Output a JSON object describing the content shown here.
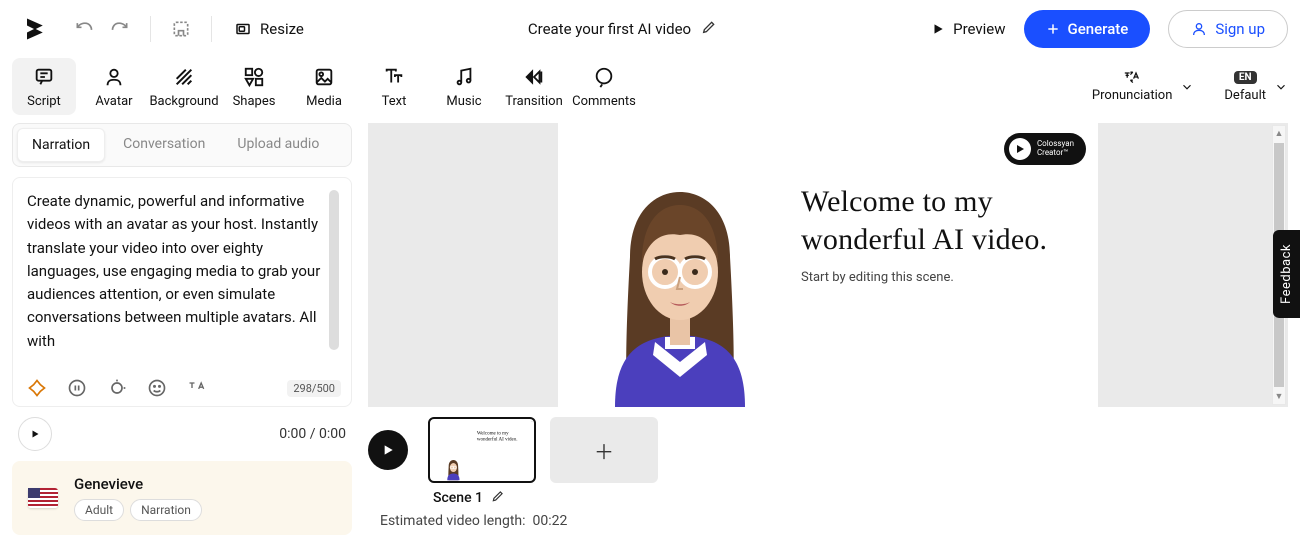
{
  "topbar": {
    "resize_label": "Resize",
    "title": "Create your first AI video",
    "preview_label": "Preview",
    "generate_label": "Generate",
    "signup_label": "Sign up"
  },
  "tools": {
    "items": [
      {
        "label": "Script"
      },
      {
        "label": "Avatar"
      },
      {
        "label": "Background"
      },
      {
        "label": "Shapes"
      },
      {
        "label": "Media"
      },
      {
        "label": "Text"
      },
      {
        "label": "Music"
      },
      {
        "label": "Transition"
      },
      {
        "label": "Comments"
      }
    ],
    "active_index": 0,
    "pronunciation_label": "Pronunciation",
    "language_badge": "EN",
    "language_label": "Default"
  },
  "script_panel": {
    "tabs": [
      {
        "label": "Narration"
      },
      {
        "label": "Conversation"
      },
      {
        "label": "Upload audio"
      }
    ],
    "active_tab": 0,
    "text": "Create dynamic, powerful and informative videos with an avatar as your host. Instantly translate your video into over eighty languages, use engaging media to grab your audiences attention, or even simulate conversations between multiple avatars. All with",
    "char_count": "298/500",
    "time": "0:00 / 0:00"
  },
  "voice": {
    "name": "Genevieve",
    "tags": [
      "Adult",
      "Narration"
    ]
  },
  "stage": {
    "title_line1": "Welcome to my",
    "title_line2": "wonderful AI video.",
    "subtitle": "Start by editing this scene.",
    "brand_text1": "Colossyan",
    "brand_text2": "Creator™"
  },
  "timeline": {
    "scene_label": "Scene 1",
    "length_prefix": "Estimated video length:",
    "length_value": "00:22"
  },
  "feedback_label": "Feedback"
}
